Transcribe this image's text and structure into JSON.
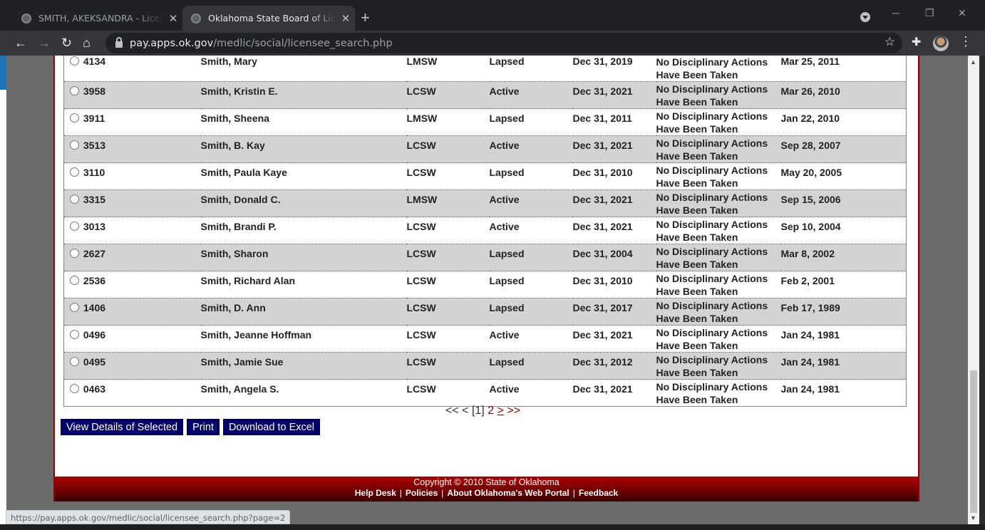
{
  "browser": {
    "tabs": [
      {
        "title": "SMITH, AKEKSANDRA - Licensee",
        "active": false
      },
      {
        "title": "Oklahoma State Board of Licensed",
        "active": true
      }
    ],
    "url_host": "pay.apps.ok.gov",
    "url_path": "/medlic/social/licensee_search.php",
    "status_url": "https://pay.apps.ok.gov/medlic/social/licensee_search.php?page=2"
  },
  "results": {
    "rows": [
      {
        "number": "4134",
        "name": "Smith, Mary",
        "type": "LMSW",
        "status": "Lapsed",
        "expires": "Dec 31, 2019",
        "discipline": "No Disciplinary Actions Have Been Taken",
        "issued": "Mar 25, 2011"
      },
      {
        "number": "3958",
        "name": "Smith, Kristin E.",
        "type": "LCSW",
        "status": "Active",
        "expires": "Dec 31, 2021",
        "discipline": "No Disciplinary Actions Have Been Taken",
        "issued": "Mar 26, 2010"
      },
      {
        "number": "3911",
        "name": "Smith, Sheena",
        "type": "LMSW",
        "status": "Lapsed",
        "expires": "Dec 31, 2011",
        "discipline": "No Disciplinary Actions Have Been Taken",
        "issued": "Jan 22, 2010"
      },
      {
        "number": "3513",
        "name": "Smith, B. Kay",
        "type": "LCSW",
        "status": "Active",
        "expires": "Dec 31, 2021",
        "discipline": "No Disciplinary Actions Have Been Taken",
        "issued": "Sep 28, 2007"
      },
      {
        "number": "3110",
        "name": "Smith, Paula Kaye",
        "type": "LCSW",
        "status": "Lapsed",
        "expires": "Dec 31, 2010",
        "discipline": "No Disciplinary Actions Have Been Taken",
        "issued": "May 20, 2005"
      },
      {
        "number": "3315",
        "name": "Smith, Donald C.",
        "type": "LMSW",
        "status": "Active",
        "expires": "Dec 31, 2021",
        "discipline": "No Disciplinary Actions Have Been Taken",
        "issued": "Sep 15, 2006"
      },
      {
        "number": "3013",
        "name": "Smith, Brandi P.",
        "type": "LCSW",
        "status": "Active",
        "expires": "Dec 31, 2021",
        "discipline": "No Disciplinary Actions Have Been Taken",
        "issued": "Sep 10, 2004"
      },
      {
        "number": "2627",
        "name": "Smith, Sharon",
        "type": "LCSW",
        "status": "Lapsed",
        "expires": "Dec 31, 2004",
        "discipline": "No Disciplinary Actions Have Been Taken",
        "issued": "Mar 8, 2002"
      },
      {
        "number": "2536",
        "name": "Smith, Richard Alan",
        "type": "LCSW",
        "status": "Lapsed",
        "expires": "Dec 31, 2010",
        "discipline": "No Disciplinary Actions Have Been Taken",
        "issued": "Feb 2, 2001"
      },
      {
        "number": "1406",
        "name": "Smith, D. Ann",
        "type": "LCSW",
        "status": "Lapsed",
        "expires": "Dec 31, 2017",
        "discipline": "No Disciplinary Actions Have Been Taken",
        "issued": "Feb 17, 1989"
      },
      {
        "number": "0496",
        "name": "Smith, Jeanne Hoffman",
        "type": "LCSW",
        "status": "Active",
        "expires": "Dec 31, 2021",
        "discipline": "No Disciplinary Actions Have Been Taken",
        "issued": "Jan 24, 1981"
      },
      {
        "number": "0495",
        "name": "Smith, Jamie Sue",
        "type": "LCSW",
        "status": "Lapsed",
        "expires": "Dec 31, 2012",
        "discipline": "No Disciplinary Actions Have Been Taken",
        "issued": "Jan 24, 1981"
      },
      {
        "number": "0463",
        "name": "Smith, Angela S.",
        "type": "LCSW",
        "status": "Active",
        "expires": "Dec 31, 2021",
        "discipline": "No Disciplinary Actions Have Been Taken",
        "issued": "Jan 24, 1981"
      }
    ]
  },
  "pager": {
    "first": "<<",
    "prev": "<",
    "current": "[1]",
    "page2": "2",
    "next": ">",
    "last": ">>"
  },
  "actions": {
    "view_details": "View Details of Selected",
    "print": "Print",
    "download": "Download to Excel"
  },
  "footer": {
    "copyright": "Copyright © 2010 State of Oklahoma",
    "links": [
      "Help Desk",
      "Policies",
      "About Oklahoma's Web Portal",
      "Feedback"
    ]
  },
  "colors": {
    "button_bg": "#000066",
    "footer_red": "#8b0000",
    "row_alt": "#d3d3d3"
  }
}
